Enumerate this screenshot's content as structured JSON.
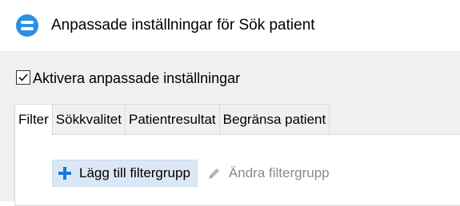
{
  "window": {
    "title": "Anpassade inställningar för Sök patient",
    "app_icon": "app-logo-icon"
  },
  "settings": {
    "enable_custom_label": "Aktivera anpassade inställningar",
    "enable_custom_checked": true
  },
  "tabs": [
    {
      "label": "Filter",
      "active": true
    },
    {
      "label": "Sökkvalitet",
      "active": false
    },
    {
      "label": "Patientresultat",
      "active": false
    },
    {
      "label": "Begränsa patient",
      "active": false
    }
  ],
  "toolbar": {
    "add_label": "Lägg till filtergrupp",
    "add_icon": "plus-icon",
    "edit_label": "Ändra filtergrupp",
    "edit_icon": "edit-icon"
  },
  "colors": {
    "accent": "#1e78d6",
    "content_background": "#f0f0f0"
  }
}
